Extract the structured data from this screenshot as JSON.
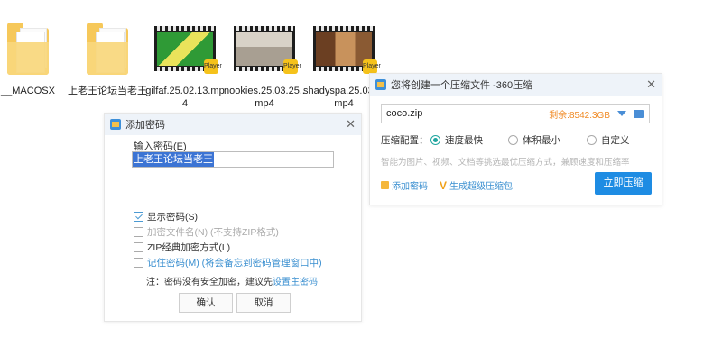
{
  "desktop": {
    "files": [
      {
        "name": "__MACOSX",
        "type": "folder"
      },
      {
        "name": "上老王论坛当老王",
        "type": "folder"
      },
      {
        "name": "gilfaf.25.02.13.mp4",
        "type": "video",
        "colors": [
          "#3aa641",
          "#e8e45b"
        ]
      },
      {
        "name": "nookies.25.03.25..mp4",
        "type": "video",
        "colors": [
          "#b8b2a8",
          "#e0d9cf"
        ]
      },
      {
        "name": "shadyspa.25.03.1.mp4",
        "type": "video",
        "colors": [
          "#7a4a2a",
          "#c8925c"
        ]
      }
    ],
    "video_badge": "Player"
  },
  "password_dialog": {
    "title": "添加密码",
    "label": "输入密码(E)",
    "value": "上老王论坛当老王",
    "options": {
      "show_password": "显示密码(S)",
      "encrypt_filename": "加密文件名(N) (不支持ZIP格式)",
      "zip_classic": "ZIP经典加密方式(L)",
      "remember": "记住密码(M) (将会备忘到密码管理窗口中)"
    },
    "note_prefix": "注：密码没有安全加密，建议先",
    "note_link": "设置主密码",
    "ok": "确认",
    "cancel": "取消"
  },
  "compress_dialog": {
    "title": "您将创建一个压缩文件 -360压缩",
    "filename": "coco.zip",
    "remaining": "剩余:8542.3GB",
    "config_label": "压缩配置：",
    "radio_fast": "速度最快",
    "radio_small": "体积最小",
    "radio_custom": "自定义",
    "hint": "智能为图片、视频、文档等挑选最优压缩方式，兼顾速度和压缩率",
    "add_password": "添加密码",
    "super_package": "生成超级压缩包",
    "start": "立即压缩"
  },
  "colors": {
    "accent": "#1e8ce3",
    "link": "#3a8fd0",
    "remaining": "#f08a24"
  }
}
